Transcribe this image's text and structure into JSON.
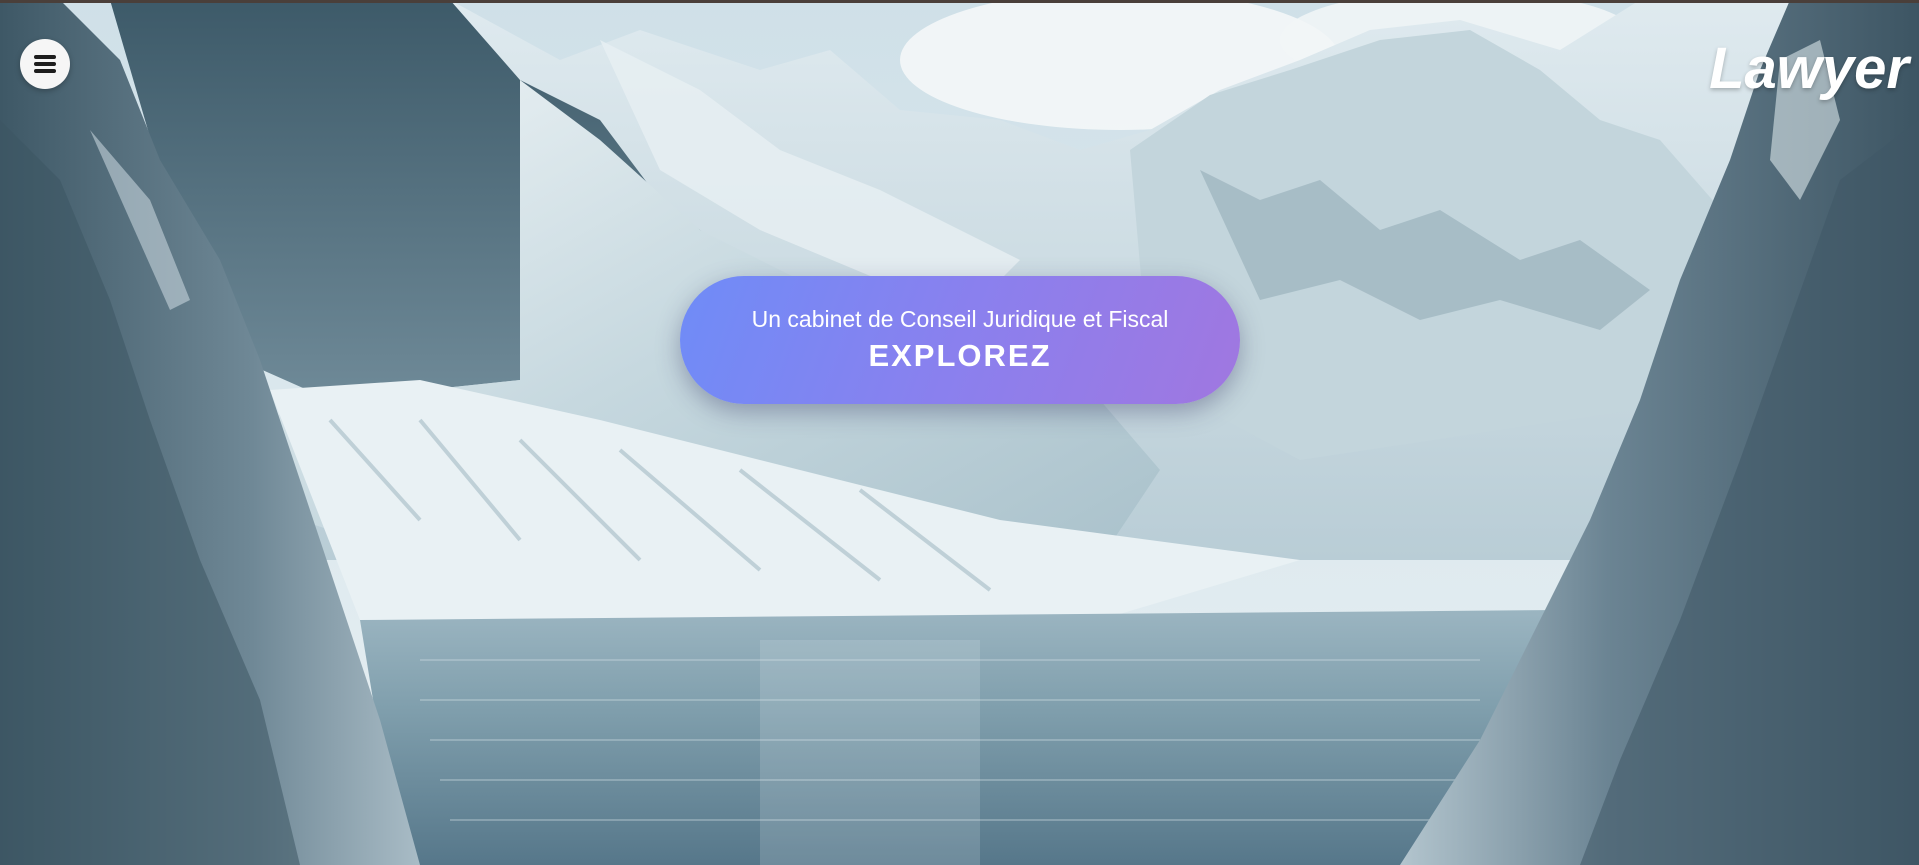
{
  "header": {
    "brand": "Lawyer",
    "menu_icon": "hamburger-menu-icon"
  },
  "hero": {
    "subtitle": "Un cabinet de Conseil Juridique et Fiscal",
    "cta_label": "EXPLOREZ",
    "background_image": "alpine-lake-mountains",
    "colors": {
      "cta_gradient_start": "#6f8cf7",
      "cta_gradient_end": "#a077e0",
      "text": "#ffffff"
    }
  }
}
